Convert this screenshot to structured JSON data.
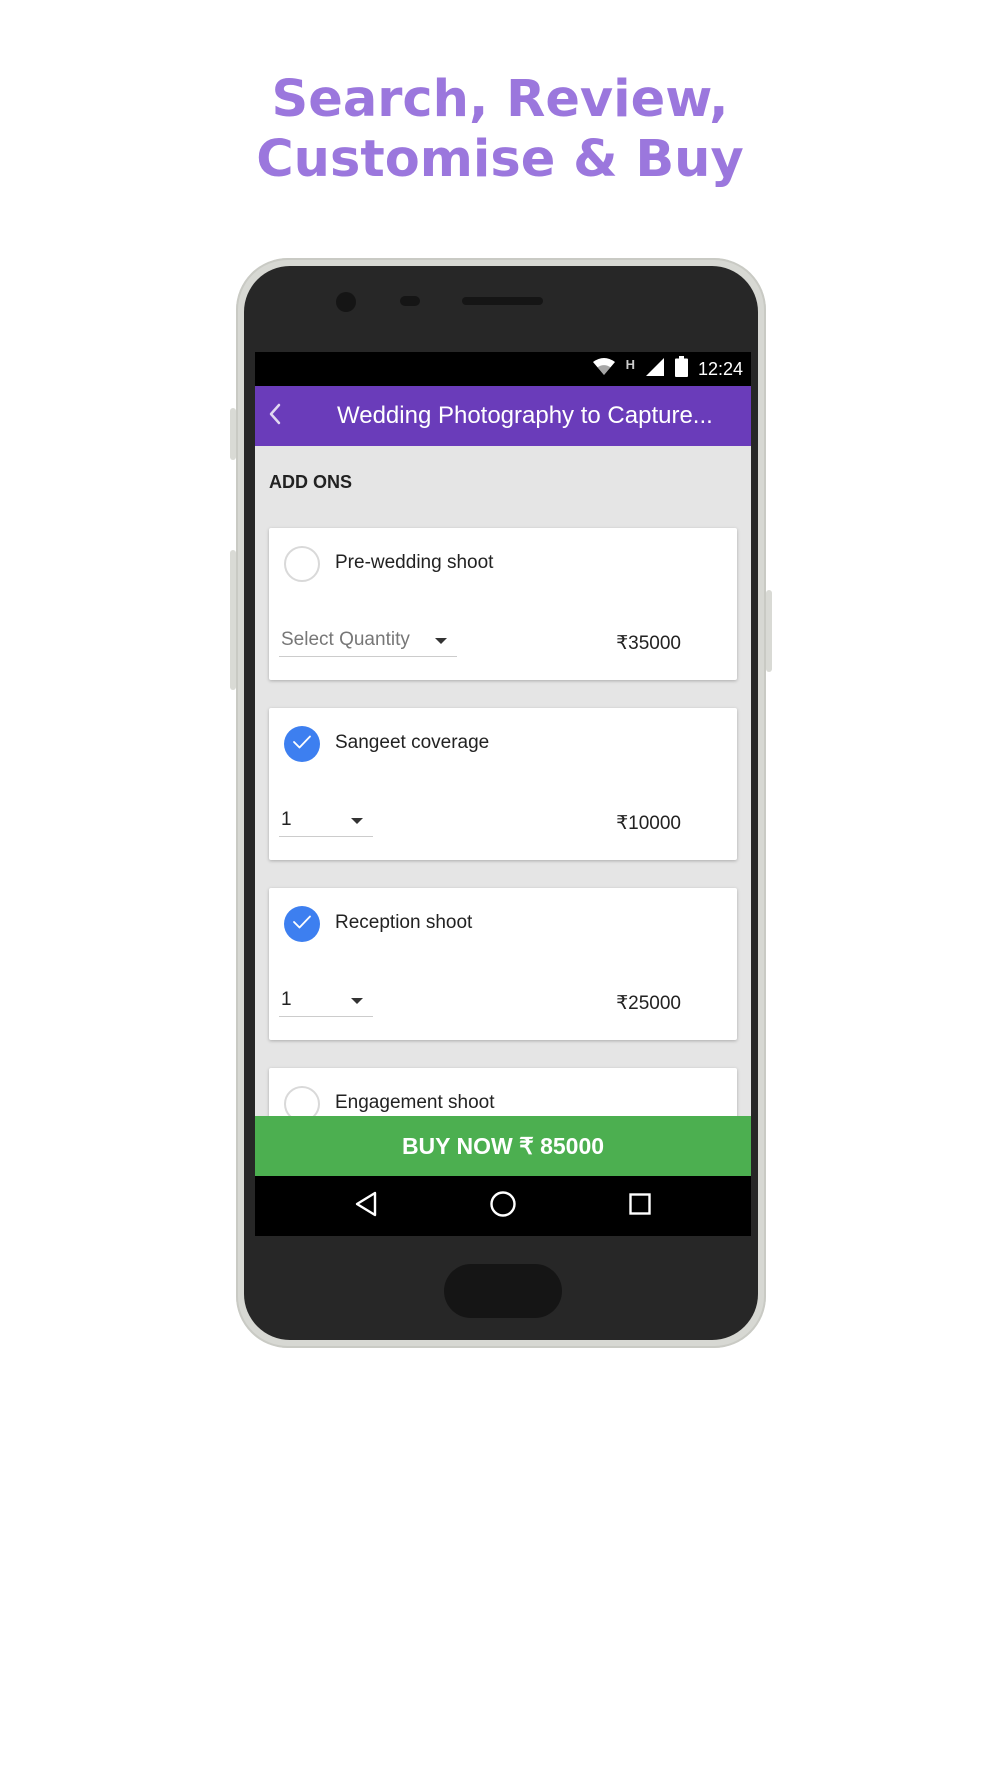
{
  "headline": {
    "line1": "Search, Review,",
    "line2": "Customise & Buy"
  },
  "status_bar": {
    "time": "12:24",
    "network_type": "H",
    "icons": [
      "wifi-icon",
      "signal-icon",
      "battery-icon"
    ]
  },
  "app_bar": {
    "back_icon": "chevron-left-icon",
    "title": "Wedding Photography to Capture..."
  },
  "section": {
    "title": "ADD ONS"
  },
  "addons": [
    {
      "name": "Pre-wedding shoot",
      "selected": false,
      "quantity_placeholder": "Select Quantity",
      "quantity": "",
      "price": "₹35000"
    },
    {
      "name": "Sangeet coverage",
      "selected": true,
      "quantity_placeholder": "",
      "quantity": "1",
      "price": "₹10000"
    },
    {
      "name": "Reception shoot",
      "selected": true,
      "quantity_placeholder": "",
      "quantity": "1",
      "price": "₹25000"
    },
    {
      "name": "Engagement shoot",
      "selected": false,
      "quantity_placeholder": "",
      "quantity": "",
      "price": ""
    }
  ],
  "buy_button": {
    "label": "BUY NOW ₹ 85000"
  },
  "nav_bar": {
    "icons": [
      "back-triangle-icon",
      "home-circle-icon",
      "recents-square-icon"
    ]
  },
  "colors": {
    "headline": "#9b77dd",
    "app_bar": "#6a3cba",
    "checkbox_selected": "#3d7ff0",
    "buy_button": "#4caf50",
    "screen_background": "#e5e5e5"
  }
}
